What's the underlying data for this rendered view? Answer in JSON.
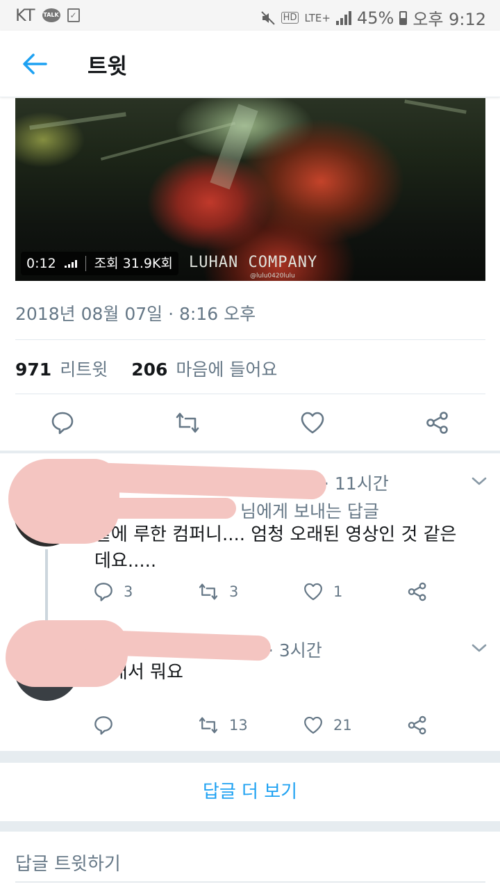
{
  "status_bar": {
    "carrier": "KT",
    "talk_badge": "TALK",
    "hd": "HD",
    "network": "LTE+",
    "battery": "45%",
    "time": "오후 9:12"
  },
  "header": {
    "title": "트윗"
  },
  "video": {
    "duration": "0:12",
    "views": "조회 31.9K회",
    "watermark": "LUHAN COMPANY",
    "watermark_sub": "@lulu0420lulu"
  },
  "tweet": {
    "timestamp": "2018년 08월 07일 · 8:16 오후",
    "retweet_count": "971",
    "retweet_label": "리트윗",
    "like_count": "206",
    "like_label": "마음에 들어요"
  },
  "replies": [
    {
      "time": "· 11시간",
      "reply_to": "님에게 보내는 답글",
      "text_line1": "밑에 루한 컴퍼니.... 엄청 오래된 영상인 것 같은",
      "text_line2": "데요.....",
      "reply_count": "3",
      "retweet_count": "3",
      "like_count": "1"
    },
    {
      "time": "· 3시간",
      "text_line1": "그래서 뭐요",
      "reply_count": "",
      "retweet_count": "13",
      "like_count": "21"
    }
  ],
  "more_replies": "답글 더 보기",
  "compose_placeholder": "답글 트윗하기",
  "colors": {
    "accent": "#1da1f2",
    "secondary_text": "#657786",
    "icon": "#657786"
  }
}
